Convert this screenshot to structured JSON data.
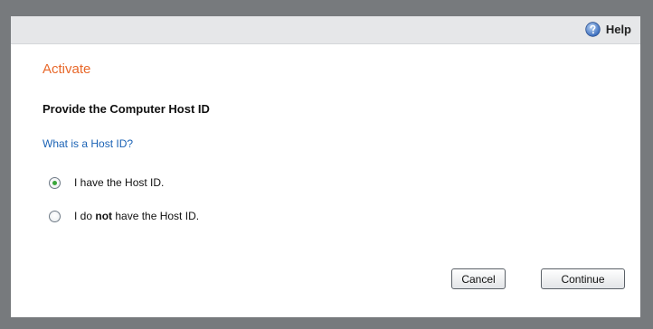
{
  "header": {
    "help_label": "Help",
    "help_icon": "help-circle-icon"
  },
  "dialog": {
    "title": "Activate",
    "subtitle": "Provide the Computer Host ID",
    "host_id_link": "What is a Host ID?",
    "options": [
      {
        "text": "I have the Host ID.",
        "selected": true
      },
      {
        "prefix": "I do ",
        "emphasis": "not",
        "suffix": " have the Host ID.",
        "selected": false
      }
    ],
    "buttons": {
      "cancel_label": "Cancel",
      "continue_label": "Continue"
    }
  },
  "colors": {
    "title": "#e8682a",
    "link": "#1a62b5",
    "header_bar": "#e6e7e9",
    "background": "#777a7d",
    "radio_selected": "#3aa53a"
  }
}
